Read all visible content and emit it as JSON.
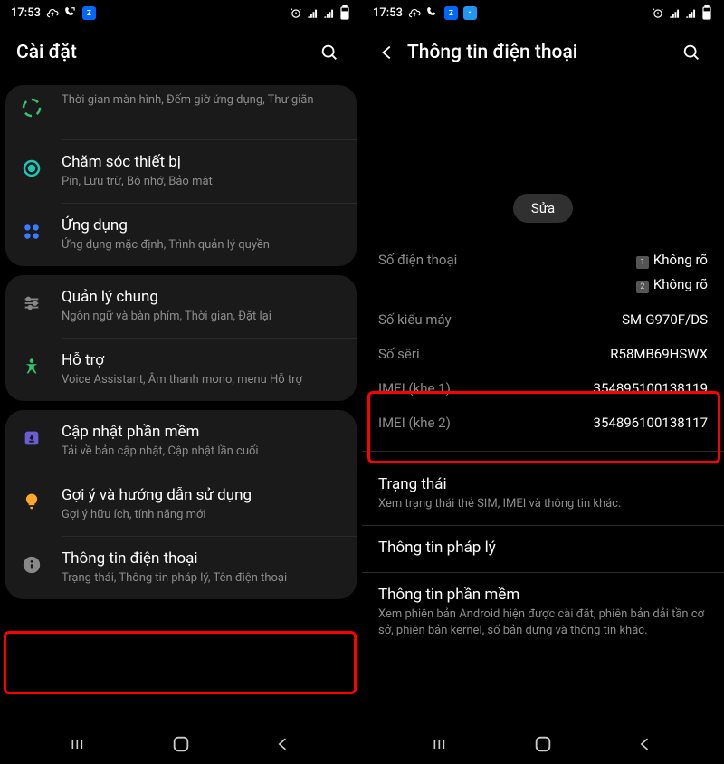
{
  "statusbar": {
    "time": "17:53",
    "icons_left": [
      "cloud-upload",
      "call-fwd",
      "app-zalo"
    ],
    "icons_left_b": [
      "cloud-upload",
      "call-fwd",
      "app-zalo",
      "app-download"
    ],
    "icons_right": [
      "alarm",
      "signal-dual",
      "battery"
    ]
  },
  "left": {
    "header_title": "Cài đặt",
    "group1": {
      "wellbeing_subtitle": "Thời gian màn hình, Đếm giờ ứng dụng, Thư giãn",
      "devicecare_title": "Chăm sóc thiết bị",
      "devicecare_subtitle": "Pin, Lưu trữ, Bộ nhớ, Bảo mật",
      "apps_title": "Ứng dụng",
      "apps_subtitle": "Ứng dụng mặc định, Trình quản lý quyền"
    },
    "group2": {
      "general_title": "Quản lý chung",
      "general_subtitle": "Ngôn ngữ và bàn phím, Thời gian, Đặt lại",
      "access_title": "Hỗ trợ",
      "access_subtitle": "Voice Assistant, Âm thanh mono, menu Hỗ trợ"
    },
    "group3": {
      "update_title": "Cập nhật phần mềm",
      "update_subtitle": "Tải về bản cập nhật, Cập nhật lần cuối",
      "tips_title": "Gợi ý và hướng dẫn sử dụng",
      "tips_subtitle": "Gợi ý hữu ích, tính năng mới",
      "about_title": "Thông tin điện thoại",
      "about_subtitle": "Trạng thái, Thông tin pháp lý, Tên điện thoại"
    }
  },
  "right": {
    "header_title": "Thông tin điện thoại",
    "edit_label": "Sửa",
    "phone_label": "Số điện thoại",
    "sim1_value": "Không rõ",
    "sim2_value": "Không rõ",
    "model_label": "Số kiểu máy",
    "model_value": "SM-G970F/DS",
    "serial_label": "Số sêri",
    "serial_value": "R58MB69HSWX",
    "imei1_label": "IMEI (khe 1)",
    "imei1_value": "354895100138119",
    "imei2_label": "IMEI (khe 2)",
    "imei2_value": "354896100138117",
    "status_title": "Trạng thái",
    "status_subtitle": "Xem trạng thái thẻ SIM, IMEI và thông tin khác.",
    "legal_title": "Thông tin pháp lý",
    "software_title": "Thông tin phần mềm",
    "software_subtitle": "Xem phiên bản Android hiện được cài đặt, phiên bản dải tần cơ sở, phiên bản kernel, số bản dựng và thông tin khác."
  }
}
